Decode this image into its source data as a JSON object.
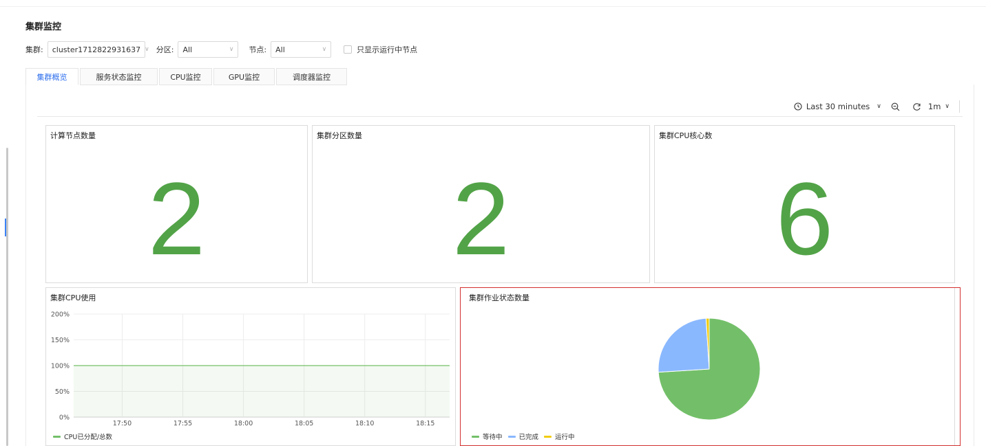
{
  "page": {
    "title": "集群监控"
  },
  "filters": {
    "cluster": {
      "label": "集群:",
      "value": "cluster1712822931637"
    },
    "partition": {
      "label": "分区:",
      "value": "All"
    },
    "node": {
      "label": "节点:",
      "value": "All"
    },
    "running_only": {
      "label": "只显示运行中节点",
      "checked": false
    }
  },
  "tabs": [
    {
      "label": "集群概览",
      "active": true
    },
    {
      "label": "服务状态监控"
    },
    {
      "label": "CPU监控"
    },
    {
      "label": "GPU监控"
    },
    {
      "label": "调度器监控"
    }
  ],
  "toolbar": {
    "time_range": "Last 30 minutes",
    "refresh_interval": "1m"
  },
  "stats": [
    {
      "title": "计算节点数量",
      "value": "2"
    },
    {
      "title": "集群分区数量",
      "value": "2"
    },
    {
      "title": "集群CPU核心数",
      "value": "6"
    }
  ],
  "colors": {
    "accent": "#2f6fed",
    "stat": "#52a347",
    "selected_border": "#d32f2f"
  },
  "chart_data": [
    {
      "type": "line",
      "title": "集群CPU使用",
      "y_ticks": [
        "200%",
        "150%",
        "100%",
        "50%",
        "0%"
      ],
      "ylim": [
        0,
        200
      ],
      "x_ticks": [
        "17:50",
        "17:55",
        "18:00",
        "18:05",
        "18:10",
        "18:15"
      ],
      "series": [
        {
          "name": "CPU已分配/总数",
          "color": "#73bf69",
          "points": [
            [
              "17:46",
              100
            ],
            [
              "18:17",
              100
            ]
          ]
        }
      ],
      "grid": true,
      "legend": "bottom-left"
    },
    {
      "type": "pie",
      "title": "集群作业状态数量",
      "slices": [
        {
          "label": "等待中",
          "value": 74,
          "color": "#73bf69"
        },
        {
          "label": "已完成",
          "value": 25,
          "color": "#8ab8ff"
        },
        {
          "label": "运行中",
          "value": 1,
          "color": "#f2cc0c"
        }
      ],
      "legend": "bottom-left",
      "selected": true
    }
  ]
}
